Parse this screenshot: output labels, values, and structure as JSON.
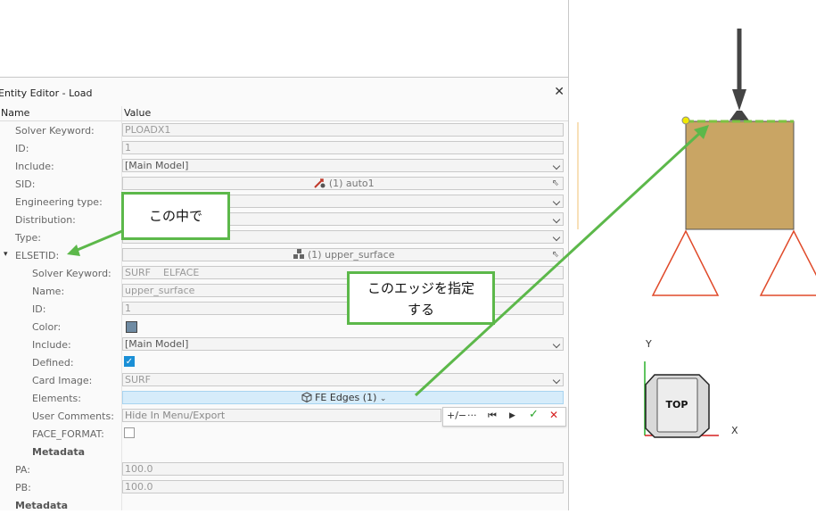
{
  "editor": {
    "title": "Entity Editor - Load",
    "col_name": "Name",
    "col_value": "Value"
  },
  "rows": {
    "solver_keyword": {
      "label": "Solver Keyword:",
      "value": "PLOADX1"
    },
    "id": {
      "label": "ID:",
      "value": "1"
    },
    "include": {
      "label": "Include:",
      "value": "[Main Model]"
    },
    "sid": {
      "label": "SID:",
      "value": "(1) auto1"
    },
    "engineering_type": {
      "label": "Engineering type:",
      "value": ""
    },
    "distribution": {
      "label": "Distribution:",
      "value": ""
    },
    "type": {
      "label": "Type:",
      "value": ""
    },
    "elsetid": {
      "label": "ELSETID:",
      "value": "(1) upper_surface"
    },
    "sub_solver_keyword": {
      "label": "Solver Keyword:",
      "value": "SURF    ELFACE"
    },
    "sub_name": {
      "label": "Name:",
      "value": "upper_surface"
    },
    "sub_id": {
      "label": "ID:",
      "value": "1"
    },
    "sub_color": {
      "label": "Color:",
      "color": "#6f8ba3"
    },
    "sub_include": {
      "label": "Include:",
      "value": "[Main Model]"
    },
    "sub_defined": {
      "label": "Defined:",
      "checked": true
    },
    "sub_card_image": {
      "label": "Card Image:",
      "value": "SURF"
    },
    "sub_elements": {
      "label": "Elements:",
      "value": "FE Edges (1)"
    },
    "sub_user_comments": {
      "label": "User Comments:",
      "value": "Hide In Menu/Export"
    },
    "sub_face_format": {
      "label": "FACE_FORMAT:",
      "checked": false
    },
    "sub_metadata": {
      "label": "Metadata"
    },
    "pa": {
      "label": "PA:",
      "value": "100.0"
    },
    "pb": {
      "label": "PB:",
      "value": "100.0"
    },
    "metadata": {
      "label": "Metadata"
    }
  },
  "toolbar": {
    "plus_minus": "+/−",
    "more": "···",
    "first": "⏮",
    "play": "▶",
    "ok": "✓",
    "cancel": "✕"
  },
  "annotations": {
    "callout1": "この中で",
    "callout2_line1": "このエッジを指定",
    "callout2_line2": "する",
    "arrow_color": "#5cb84a"
  },
  "viewport": {
    "view_cube_label": "TOP",
    "axis_y": "Y",
    "axis_x": "X",
    "block_color": "#c9a564",
    "support_color": "#e04a2a",
    "edge_highlight_color": "#7dc242"
  }
}
